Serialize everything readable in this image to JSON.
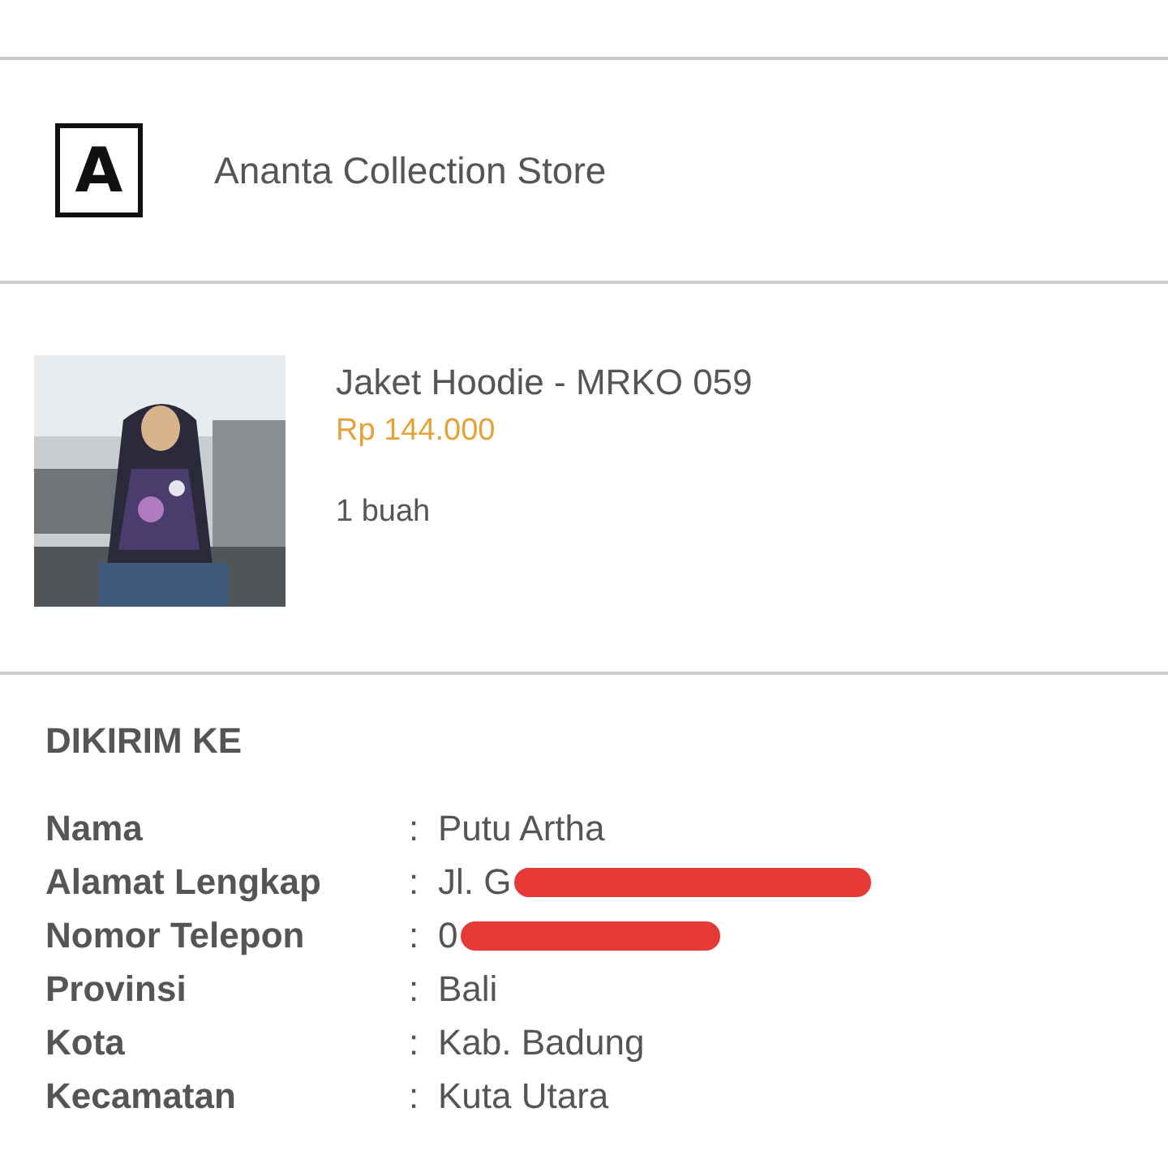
{
  "store": {
    "name": "Ananta Collection Store",
    "logo_letter": "A"
  },
  "product": {
    "name": "Jaket Hoodie - MRKO 059",
    "price": "Rp 144.000",
    "quantity": "1 buah"
  },
  "shipping": {
    "heading": "DIKIRIM KE",
    "fields": [
      {
        "label": "Nama",
        "separator": ":",
        "value": "Putu Artha",
        "redacted": false
      },
      {
        "label": "Alamat Lengkap",
        "separator": ":",
        "value": "Jl. G",
        "redacted": true
      },
      {
        "label": "Nomor Telepon",
        "separator": ":",
        "value": "0",
        "redacted": true
      },
      {
        "label": "Provinsi",
        "separator": ":",
        "value": "Bali",
        "redacted": false
      },
      {
        "label": "Kota",
        "separator": ":",
        "value": "Kab. Badung",
        "redacted": false
      },
      {
        "label": "Kecamatan",
        "separator": ":",
        "value": "Kuta Utara",
        "redacted": false
      }
    ]
  }
}
